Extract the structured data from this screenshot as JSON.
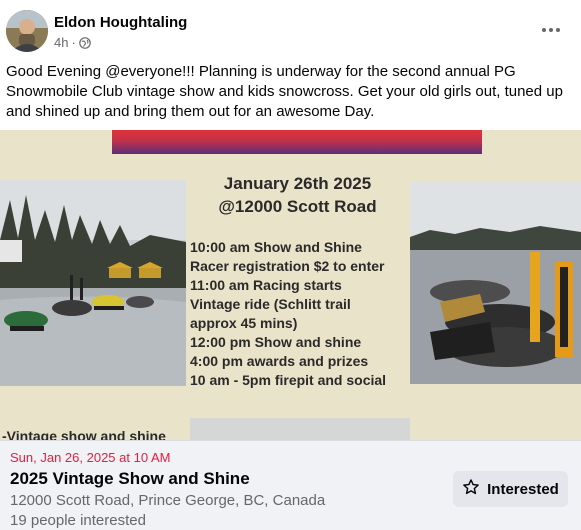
{
  "post": {
    "author": "Eldon Houghtaling",
    "time": "4h",
    "separator": "·",
    "audience_icon": "globe-icon",
    "more_icon": "more-options-icon",
    "text": "Good Evening @everyone!!! Planning is underway for the second annual PG Snowmobile Club vintage show and kids snowcross. Get your old girls out, tuned up and shined up and bring them out for an awesome Day."
  },
  "poster": {
    "date_line": "January 26th 2025",
    "location_line": "@12000 Scott Road",
    "schedule": [
      "10:00 am Show and Shine",
      "Racer registration $2 to enter",
      "11:00 am Racing starts",
      "Vintage ride (Schlitt trail",
      "approx 45 mins)",
      "12:00 pm Show and shine",
      "4:00 pm awards and prizes",
      "10 am - 5pm firepit and social"
    ],
    "bottom_caption": "-Vintage show and shine"
  },
  "event": {
    "date": "Sun, Jan 26, 2025 at 10 AM",
    "title": "2025 Vintage Show and Shine",
    "location": "12000 Scott Road, Prince George, BC, Canada",
    "interested_count": "19 people interested",
    "interested_button": "Interested",
    "accent_color": "#e41e3f"
  }
}
